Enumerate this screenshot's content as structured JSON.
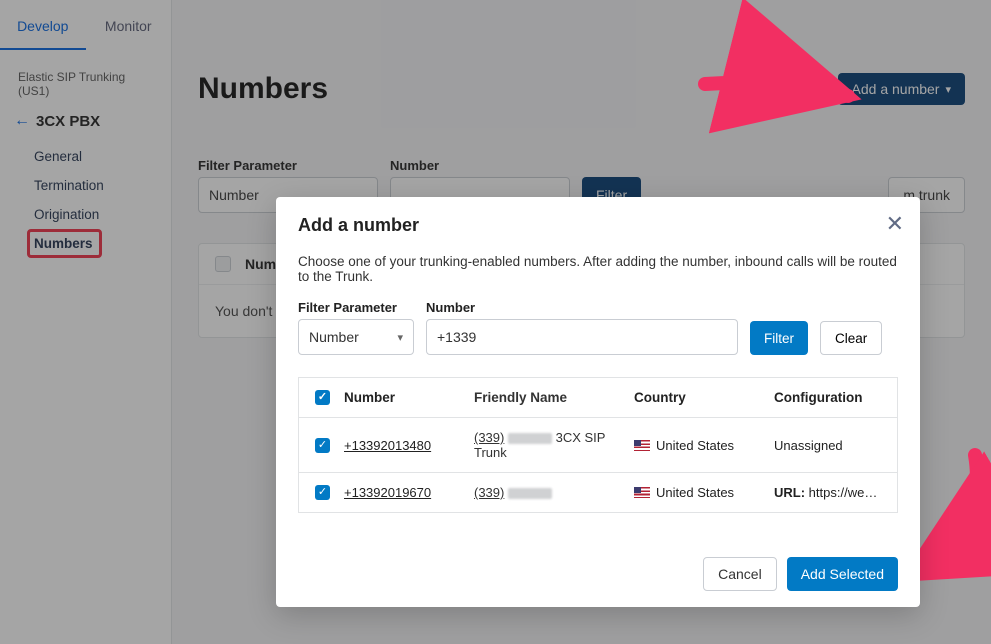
{
  "tabs": {
    "develop": "Develop",
    "monitor": "Monitor"
  },
  "region": "Elastic SIP Trunking (US1)",
  "crumb": "3CX PBX",
  "nav": {
    "general": "General",
    "termination": "Termination",
    "origination": "Origination",
    "numbers": "Numbers"
  },
  "page": {
    "title": "Numbers",
    "add_button": "Add a number",
    "filter_param_label": "Filter Parameter",
    "filter_param_value": "Number",
    "number_label": "Number",
    "filter_btn": "Filter",
    "open_trunk_btn": "m trunk",
    "table_header": "Numb",
    "empty_text": "You don't ha"
  },
  "modal": {
    "title": "Add a number",
    "desc": "Choose one of your trunking-enabled numbers. After adding the number, inbound calls will be routed to the Trunk.",
    "filter_param_label": "Filter Parameter",
    "filter_param_value": "Number",
    "number_label": "Number",
    "number_value": "+1339",
    "filter_btn": "Filter",
    "clear_btn": "Clear",
    "th_number": "Number",
    "th_fname": "Friendly Name",
    "th_country": "Country",
    "th_config": "Configuration",
    "rows": [
      {
        "number": "+13392013480",
        "fname_pre": "(339)",
        "fname_post": "3CX SIP Trunk",
        "country": "United States",
        "config": "Unassigned"
      },
      {
        "number": "+13392019670",
        "fname_pre": "(339)",
        "fname_post": "",
        "country": "United States",
        "config_label": "URL:",
        "config_val": "https://webhoo…"
      }
    ],
    "cancel": "Cancel",
    "add_selected": "Add Selected"
  }
}
